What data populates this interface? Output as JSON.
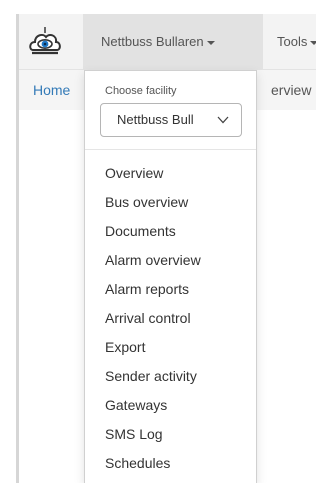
{
  "navbar": {
    "logo_icon": "cloud-eye-logo-icon",
    "facility_label": "Nettbuss Bullaren",
    "tools_label": "Tools"
  },
  "breadcrumb": {
    "home": "Home",
    "current_partial": "erview"
  },
  "facility_dropdown": {
    "choose_label": "Choose facility",
    "selected_value": "Nettbuss Bull",
    "menu_items": [
      "Overview",
      "Bus overview",
      "Documents",
      "Alarm overview",
      "Alarm reports",
      "Arrival control",
      "Export",
      "Sender activity",
      "Gateways",
      "SMS Log",
      "Schedules"
    ]
  },
  "colors": {
    "link": "#337ab7",
    "navbar_bg": "#f3f3f3",
    "active_nav_bg": "#e2e2e2",
    "text": "#333333"
  }
}
